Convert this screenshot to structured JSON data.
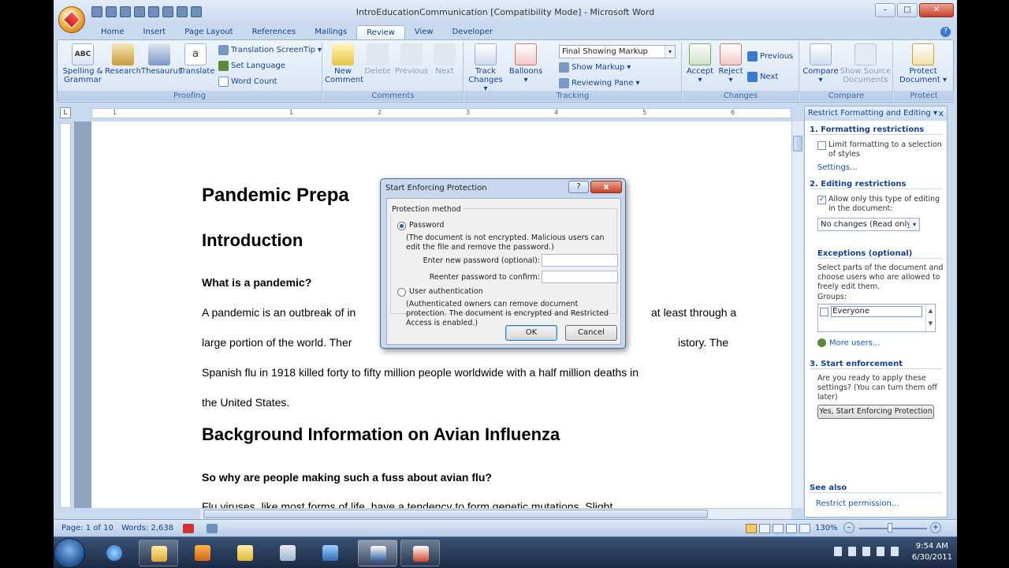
{
  "window": {
    "title": "IntroEducationCommunication [Compatibility Mode] - Microsoft Word",
    "help": "?"
  },
  "tabs": [
    "Home",
    "Insert",
    "Page Layout",
    "References",
    "Mailings",
    "Review",
    "View",
    "Developer"
  ],
  "ribbon": {
    "proofing": {
      "label": "Proofing",
      "spelling": "Spelling & Grammar",
      "research": "Research",
      "thesaurus": "Thesaurus",
      "translate": "Translate",
      "translation_screentip": "Translation ScreenTip",
      "set_language": "Set Language",
      "word_count": "Word Count"
    },
    "comments": {
      "label": "Comments",
      "new_comment": "New Comment",
      "delete": "Delete",
      "previous": "Previous",
      "next": "Next"
    },
    "tracking": {
      "label": "Tracking",
      "track_changes": "Track Changes",
      "balloons": "Balloons",
      "markup_combo": "Final Showing Markup",
      "show_markup": "Show Markup",
      "reviewing_pane": "Reviewing Pane"
    },
    "changes": {
      "label": "Changes",
      "accept": "Accept",
      "reject": "Reject",
      "previous": "Previous",
      "next": "Next"
    },
    "compare": {
      "label": "Compare",
      "compare": "Compare",
      "show_source": "Show Source Documents"
    },
    "protect": {
      "label": "Protect",
      "protect_document": "Protect Document"
    }
  },
  "ruler_numbers": [
    "1",
    "1",
    "2",
    "3",
    "4",
    "5",
    "6"
  ],
  "document": {
    "title": "Pandemic Prepa",
    "intro": "Introduction",
    "q1": "What is a pandemic?",
    "p1a": "A pandemic is an outbreak of in",
    "p1b": "at least through a",
    "p2a": "large portion of the world. Ther",
    "p2b": "istory. The",
    "p3": "Spanish flu in 1918 killed forty to fifty million people worldwide with a half million deaths in",
    "p4": "the United States.",
    "h2": "Background Information on Avian Influenza",
    "q2": "So why are people making such a fuss about avian flu?",
    "p5": "Flu viruses, like most forms of life, have a tendency to form genetic mutations. Slight"
  },
  "dialog": {
    "title": "Start Enforcing Protection",
    "help": "?",
    "close": "x",
    "method_label": "Protection method",
    "password_label": "Password",
    "password_desc": "(The document is not encrypted. Malicious users can edit the file and remove the password.)",
    "enter_password": "Enter new password (optional):",
    "reenter_password": "Reenter password to confirm:",
    "user_auth_label": "User authentication",
    "user_auth_desc": "(Authenticated owners can remove document protection. The document is encrypted and Restricted Access is enabled.)",
    "ok": "OK",
    "cancel": "Cancel"
  },
  "pane": {
    "title": "Restrict Formatting and Editing",
    "close": "x",
    "sec1": "1. Formatting restrictions",
    "limit_formatting": "Limit formatting to a selection of styles",
    "settings": "Settings...",
    "sec2": "2. Editing restrictions",
    "allow_editing": "Allow only this type of editing in the document:",
    "editing_combo": "No changes (Read only)",
    "exceptions": "Exceptions (optional)",
    "exceptions_desc": "Select parts of the document and choose users who are allowed to freely edit them.",
    "groups": "Groups:",
    "everyone": "Everyone",
    "more_users": "More users...",
    "sec3": "3. Start enforcement",
    "enforce_desc": "Are you ready to apply these settings? (You can turn them off later)",
    "enforce_button": "Yes, Start Enforcing Protection",
    "see_also": "See also",
    "restrict_permission": "Restrict permission..."
  },
  "status": {
    "page": "Page: 1 of 10",
    "words": "Words: 2,638",
    "zoom": "130%"
  },
  "clock": {
    "time": "9:54 AM",
    "date": "6/30/2011"
  }
}
